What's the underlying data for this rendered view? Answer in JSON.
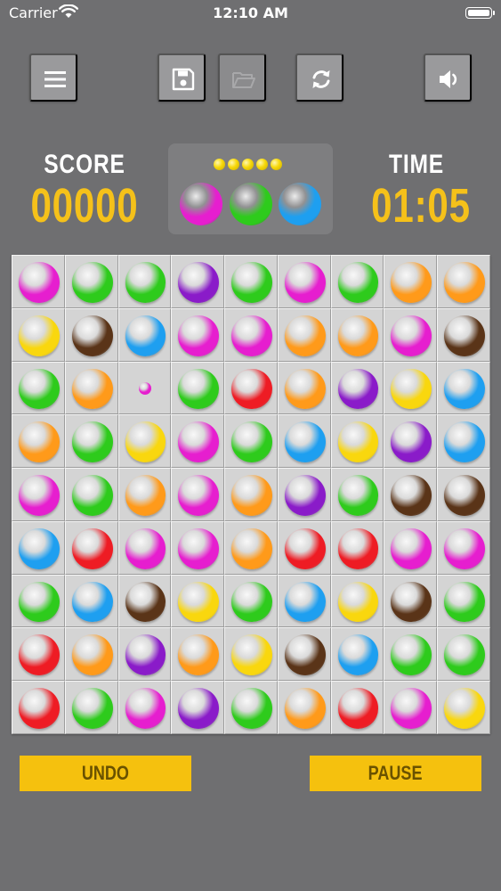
{
  "status_bar": {
    "carrier": "Carrier",
    "time": "12:10 AM"
  },
  "toolbar": {
    "buttons": [
      {
        "name": "menu",
        "icon": "menu-icon",
        "enabled": true
      },
      {
        "name": "save",
        "icon": "floppy-disk-icon",
        "enabled": true
      },
      {
        "name": "open",
        "icon": "folder-open-icon",
        "enabled": false
      },
      {
        "name": "restart",
        "icon": "refresh-icon",
        "enabled": true
      },
      {
        "name": "sound",
        "icon": "speaker-icon",
        "enabled": true
      }
    ]
  },
  "score": {
    "label": "SCORE",
    "value": "00000"
  },
  "time": {
    "label": "TIME",
    "value": "01:05"
  },
  "next_balls": {
    "dots_count": 5,
    "colors": [
      "magenta",
      "green",
      "blue"
    ]
  },
  "board": {
    "rows": 9,
    "cols": 9,
    "cells": [
      [
        "magenta",
        "green",
        "green",
        "purple",
        "green",
        "magenta",
        "green",
        "orange",
        "orange"
      ],
      [
        "yellow",
        "brown",
        "blue",
        "magenta",
        "magenta",
        "orange",
        "orange",
        "magenta",
        "brown"
      ],
      [
        "green",
        "orange",
        "magenta-small",
        "green",
        "red",
        "orange",
        "purple",
        "yellow",
        "blue"
      ],
      [
        "orange",
        "green",
        "yellow",
        "magenta",
        "green",
        "blue",
        "yellow",
        "purple",
        "blue"
      ],
      [
        "magenta",
        "green",
        "orange",
        "magenta",
        "orange",
        "purple",
        "green",
        "brown",
        "brown"
      ],
      [
        "blue",
        "red",
        "magenta",
        "magenta",
        "orange",
        "red",
        "red",
        "magenta",
        "magenta"
      ],
      [
        "green",
        "blue",
        "brown",
        "yellow",
        "green",
        "blue",
        "yellow",
        "brown",
        "green"
      ],
      [
        "red",
        "orange",
        "purple",
        "orange",
        "yellow",
        "brown",
        "blue",
        "green",
        "green"
      ],
      [
        "red",
        "green",
        "magenta",
        "purple",
        "green",
        "orange",
        "red",
        "magenta",
        "yellow"
      ]
    ]
  },
  "actions": {
    "undo_label": "UNDO",
    "pause_label": "PAUSE"
  },
  "colors": {
    "background": "#6f6f71",
    "accent_yellow": "#f5c11a",
    "magenta": "#e61ecf",
    "green": "#2ecb1c",
    "purple": "#8a1bc9",
    "orange": "#ff9a1a",
    "yellow": "#f9d70e",
    "brown": "#5a3418",
    "blue": "#1e9ff0",
    "red": "#ee1c24"
  }
}
